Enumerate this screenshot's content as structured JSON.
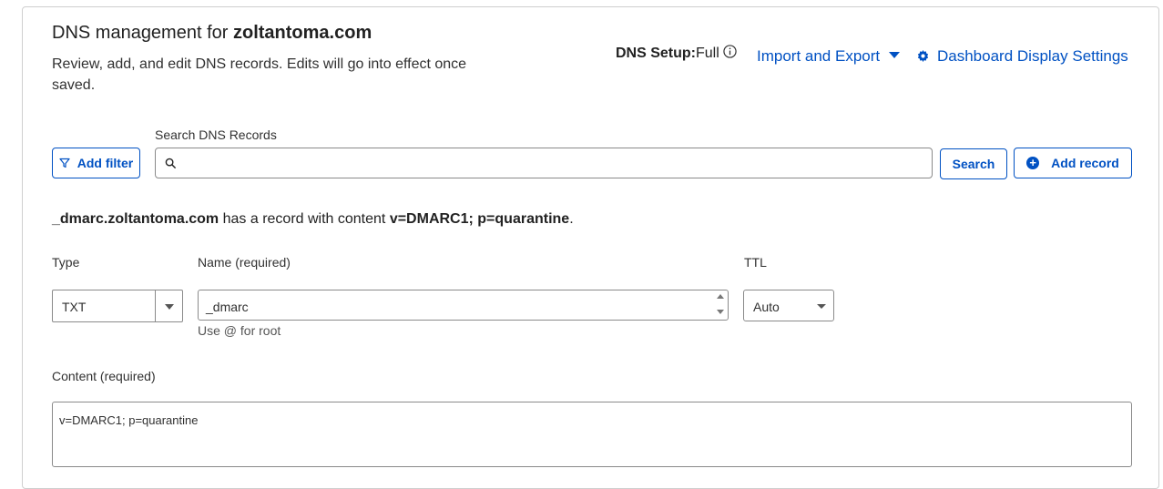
{
  "header": {
    "title_prefix": "DNS management for ",
    "domain": "zoltantoma.com",
    "description": "Review, add, and edit DNS records. Edits will go into effect once saved."
  },
  "setup": {
    "label": "DNS Setup:",
    "value": "Full"
  },
  "actions": {
    "import_export": "Import and Export",
    "dashboard_settings": "Dashboard Display Settings"
  },
  "search": {
    "label": "Search DNS Records",
    "value": "",
    "filter_button": "Add filter",
    "search_button": "Search",
    "add_record_button": "Add record"
  },
  "record_message": {
    "name": "_dmarc.zoltantoma.com",
    "middle": " has a record with content ",
    "content": "v=DMARC1; p=quarantine",
    "end": "."
  },
  "form": {
    "type_label": "Type",
    "type_value": "TXT",
    "name_label": "Name (required)",
    "name_value": "_dmarc",
    "name_hint": "Use @ for root",
    "ttl_label": "TTL",
    "ttl_value": "Auto",
    "content_label": "Content (required)",
    "content_value": "v=DMARC1; p=quarantine"
  },
  "colors": {
    "accent": "#0051c3",
    "text": "#313131",
    "border": "#8a8a8a"
  },
  "icons": [
    "info-icon",
    "caret-down-icon",
    "gear-icon",
    "filter-icon",
    "search-icon",
    "plus-circle-icon",
    "chevron-down-icon"
  ]
}
